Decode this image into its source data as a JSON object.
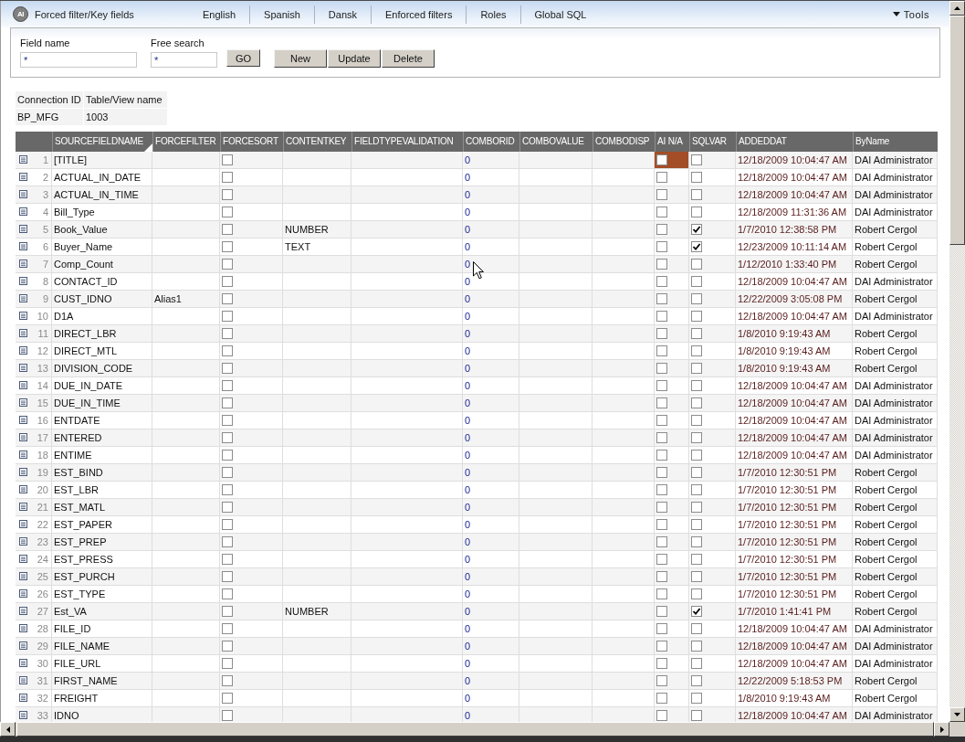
{
  "header": {
    "logo": "AI",
    "title": "Forced filter/Key fields",
    "nav": [
      "English",
      "Spanish",
      "Dansk",
      "Enforced filters",
      "Roles",
      "Global SQL"
    ],
    "tools": "Tools"
  },
  "filters": {
    "fields": [
      {
        "label": "Field name",
        "value": "*"
      },
      {
        "label": "Free search",
        "value": "*"
      }
    ],
    "go_button": "GO",
    "actions": [
      "New",
      "Update",
      "Delete"
    ]
  },
  "connection": {
    "columns": [
      "Connection ID",
      "Table/View name"
    ],
    "values": [
      "BP_MFG",
      "1003"
    ]
  },
  "table": {
    "columns": [
      {
        "label": "SOURCEFIELDNAME",
        "kind": "text",
        "sorted": true
      },
      {
        "label": "FORCEFILTER",
        "kind": "text",
        "sorted": false
      },
      {
        "label": "FORCESORT",
        "kind": "check",
        "sorted": false
      },
      {
        "label": "CONTENTKEY",
        "kind": "text",
        "sorted": false
      },
      {
        "label": "FIELDTYPEVALIDATION",
        "kind": "text",
        "sorted": false
      },
      {
        "label": "COMBORID",
        "kind": "id",
        "sorted": false
      },
      {
        "label": "COMBOVALUE",
        "kind": "text",
        "sorted": false
      },
      {
        "label": "COMBODISP",
        "kind": "text",
        "sorted": false
      },
      {
        "label": "AI N/A",
        "kind": "check",
        "sorted": false
      },
      {
        "label": "SQLVAR",
        "kind": "check",
        "sorted": false
      },
      {
        "label": "ADDEDDAT",
        "kind": "date",
        "sorted": false
      },
      {
        "label": "ByName",
        "kind": "text",
        "sorted": false
      }
    ],
    "rows": [
      {
        "number": "1",
        "source": "[TITLE]",
        "sort": false,
        "combo_id": "0",
        "ai_na": false,
        "ai_na_focused": true,
        "sql_var": false,
        "added": "12/18/2009 10:04:47 AM",
        "by": "DAI Administrator"
      },
      {
        "number": "2",
        "source": "ACTUAL_IN_DATE",
        "sort": false,
        "combo_id": "0",
        "ai_na": false,
        "ai_na_focused": false,
        "sql_var": false,
        "added": "12/18/2009 10:04:47 AM",
        "by": "DAI Administrator"
      },
      {
        "number": "3",
        "source": "ACTUAL_IN_TIME",
        "sort": false,
        "combo_id": "0",
        "ai_na": false,
        "ai_na_focused": false,
        "sql_var": false,
        "added": "12/18/2009 10:04:47 AM",
        "by": "DAI Administrator"
      },
      {
        "number": "4",
        "source": "Bill_Type",
        "sort": false,
        "combo_id": "0",
        "ai_na": false,
        "ai_na_focused": false,
        "sql_var": false,
        "added": "12/18/2009 11:31:36 AM",
        "by": "DAI Administrator"
      },
      {
        "number": "5",
        "source": "Book_Value",
        "sort": false,
        "content_key": "NUMBER",
        "combo_id": "0",
        "ai_na": false,
        "ai_na_focused": false,
        "sql_var": true,
        "added": "1/7/2010 12:38:58 PM",
        "by": "Robert Cergol"
      },
      {
        "number": "6",
        "source": "Buyer_Name",
        "sort": false,
        "content_key": "TEXT",
        "combo_id": "0",
        "ai_na": false,
        "ai_na_focused": false,
        "sql_var": true,
        "added": "12/23/2009 10:11:14 AM",
        "by": "Robert Cergol"
      },
      {
        "number": "7",
        "source": "Comp_Count",
        "sort": false,
        "combo_id": "0",
        "ai_na": false,
        "ai_na_focused": false,
        "sql_var": false,
        "added": "1/12/2010 1:33:40 PM",
        "by": "Robert Cergol"
      },
      {
        "number": "8",
        "source": "CONTACT_ID",
        "sort": false,
        "combo_id": "0",
        "ai_na": false,
        "ai_na_focused": false,
        "sql_var": false,
        "added": "12/18/2009 10:04:47 AM",
        "by": "DAI Administrator"
      },
      {
        "number": "9",
        "source": "CUST_IDNO",
        "filter": "Alias1",
        "sort": false,
        "combo_id": "0",
        "ai_na": false,
        "ai_na_focused": false,
        "sql_var": false,
        "added": "12/22/2009 3:05:08 PM",
        "by": "Robert Cergol"
      },
      {
        "number": "10",
        "source": "D1A",
        "sort": false,
        "combo_id": "0",
        "ai_na": false,
        "ai_na_focused": false,
        "sql_var": false,
        "added": "12/18/2009 10:04:47 AM",
        "by": "DAI Administrator"
      },
      {
        "number": "11",
        "source": "DIRECT_LBR",
        "sort": false,
        "combo_id": "0",
        "ai_na": false,
        "ai_na_focused": false,
        "sql_var": false,
        "added": "1/8/2010 9:19:43 AM",
        "by": "Robert Cergol"
      },
      {
        "number": "12",
        "source": "DIRECT_MTL",
        "sort": false,
        "combo_id": "0",
        "ai_na": false,
        "ai_na_focused": false,
        "sql_var": false,
        "added": "1/8/2010 9:19:43 AM",
        "by": "Robert Cergol"
      },
      {
        "number": "13",
        "source": "DIVISION_CODE",
        "sort": false,
        "combo_id": "0",
        "ai_na": false,
        "ai_na_focused": false,
        "sql_var": false,
        "added": "1/8/2010 9:19:43 AM",
        "by": "Robert Cergol"
      },
      {
        "number": "14",
        "source": "DUE_IN_DATE",
        "sort": false,
        "combo_id": "0",
        "ai_na": false,
        "ai_na_focused": false,
        "sql_var": false,
        "added": "12/18/2009 10:04:47 AM",
        "by": "DAI Administrator"
      },
      {
        "number": "15",
        "source": "DUE_IN_TIME",
        "sort": false,
        "combo_id": "0",
        "ai_na": false,
        "ai_na_focused": false,
        "sql_var": false,
        "added": "12/18/2009 10:04:47 AM",
        "by": "DAI Administrator"
      },
      {
        "number": "16",
        "source": "ENTDATE",
        "sort": false,
        "combo_id": "0",
        "ai_na": false,
        "ai_na_focused": false,
        "sql_var": false,
        "added": "12/18/2009 10:04:47 AM",
        "by": "DAI Administrator"
      },
      {
        "number": "17",
        "source": "ENTERED",
        "sort": false,
        "combo_id": "0",
        "ai_na": false,
        "ai_na_focused": false,
        "sql_var": false,
        "added": "12/18/2009 10:04:47 AM",
        "by": "DAI Administrator"
      },
      {
        "number": "18",
        "source": "ENTIME",
        "sort": false,
        "combo_id": "0",
        "ai_na": false,
        "ai_na_focused": false,
        "sql_var": false,
        "added": "12/18/2009 10:04:47 AM",
        "by": "DAI Administrator"
      },
      {
        "number": "19",
        "source": "EST_BIND",
        "sort": false,
        "combo_id": "0",
        "ai_na": false,
        "ai_na_focused": false,
        "sql_var": false,
        "added": "1/7/2010 12:30:51 PM",
        "by": "Robert Cergol"
      },
      {
        "number": "20",
        "source": "EST_LBR",
        "sort": false,
        "combo_id": "0",
        "ai_na": false,
        "ai_na_focused": false,
        "sql_var": false,
        "added": "1/7/2010 12:30:51 PM",
        "by": "Robert Cergol"
      },
      {
        "number": "21",
        "source": "EST_MATL",
        "sort": false,
        "combo_id": "0",
        "ai_na": false,
        "ai_na_focused": false,
        "sql_var": false,
        "added": "1/7/2010 12:30:51 PM",
        "by": "Robert Cergol"
      },
      {
        "number": "22",
        "source": "EST_PAPER",
        "sort": false,
        "combo_id": "0",
        "ai_na": false,
        "ai_na_focused": false,
        "sql_var": false,
        "added": "1/7/2010 12:30:51 PM",
        "by": "Robert Cergol"
      },
      {
        "number": "23",
        "source": "EST_PREP",
        "sort": false,
        "combo_id": "0",
        "ai_na": false,
        "ai_na_focused": false,
        "sql_var": false,
        "added": "1/7/2010 12:30:51 PM",
        "by": "Robert Cergol"
      },
      {
        "number": "24",
        "source": "EST_PRESS",
        "sort": false,
        "combo_id": "0",
        "ai_na": false,
        "ai_na_focused": false,
        "sql_var": false,
        "added": "1/7/2010 12:30:51 PM",
        "by": "Robert Cergol"
      },
      {
        "number": "25",
        "source": "EST_PURCH",
        "sort": false,
        "combo_id": "0",
        "ai_na": false,
        "ai_na_focused": false,
        "sql_var": false,
        "added": "1/7/2010 12:30:51 PM",
        "by": "Robert Cergol"
      },
      {
        "number": "26",
        "source": "EST_TYPE",
        "sort": false,
        "combo_id": "0",
        "ai_na": false,
        "ai_na_focused": false,
        "sql_var": false,
        "added": "1/7/2010 12:30:51 PM",
        "by": "Robert Cergol"
      },
      {
        "number": "27",
        "source": "Est_VA",
        "sort": false,
        "content_key": "NUMBER",
        "combo_id": "0",
        "ai_na": false,
        "ai_na_focused": false,
        "sql_var": true,
        "added": "1/7/2010 1:41:41 PM",
        "by": "Robert Cergol"
      },
      {
        "number": "28",
        "source": "FILE_ID",
        "sort": false,
        "combo_id": "0",
        "ai_na": false,
        "ai_na_focused": false,
        "sql_var": false,
        "added": "12/18/2009 10:04:47 AM",
        "by": "DAI Administrator"
      },
      {
        "number": "29",
        "source": "FILE_NAME",
        "sort": false,
        "combo_id": "0",
        "ai_na": false,
        "ai_na_focused": false,
        "sql_var": false,
        "added": "12/18/2009 10:04:47 AM",
        "by": "DAI Administrator"
      },
      {
        "number": "30",
        "source": "FILE_URL",
        "sort": false,
        "combo_id": "0",
        "ai_na": false,
        "ai_na_focused": false,
        "sql_var": false,
        "added": "12/18/2009 10:04:47 AM",
        "by": "DAI Administrator"
      },
      {
        "number": "31",
        "source": "FIRST_NAME",
        "sort": false,
        "combo_id": "0",
        "ai_na": false,
        "ai_na_focused": false,
        "sql_var": false,
        "added": "12/22/2009 5:18:53 PM",
        "by": "Robert Cergol"
      },
      {
        "number": "32",
        "source": "FREIGHT",
        "sort": false,
        "combo_id": "0",
        "ai_na": false,
        "ai_na_focused": false,
        "sql_var": false,
        "added": "1/8/2010 9:19:43 AM",
        "by": "Robert Cergol"
      },
      {
        "number": "33",
        "source": "IDNO",
        "sort": false,
        "combo_id": "0",
        "ai_na": false,
        "ai_na_focused": false,
        "sql_var": false,
        "added": "12/18/2009 10:04:47 AM",
        "by": "DAI Administrator"
      }
    ]
  }
}
